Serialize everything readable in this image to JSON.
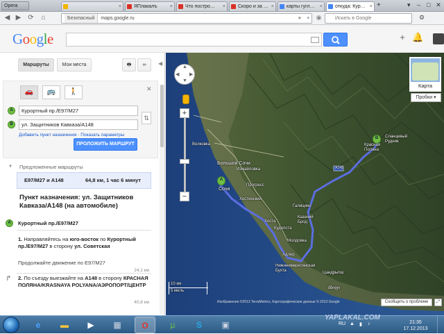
{
  "browser": {
    "menu_label": "Opera",
    "tabs": [
      {
        "label": "",
        "color": "#f4b400"
      },
      {
        "label": "ЯПлакалъ",
        "color": "#d93025"
      },
      {
        "label": "Что постро…",
        "color": "#d93025"
      },
      {
        "label": "Скоро и за …",
        "color": "#d93025"
      },
      {
        "label": "карты гугл…",
        "color": "#4285f4"
      },
      {
        "label": "откуда: Кур…",
        "color": "#4285f4"
      }
    ],
    "security_label": "Безопасный",
    "url": "maps.google.ru",
    "search_placeholder": "Искать в Google"
  },
  "header": {
    "logo": "Google"
  },
  "panel": {
    "tab_routes": "Маршруты",
    "tab_myplaces": "Мои места",
    "pin_a": "A",
    "pin_b": "B",
    "field_a": "Курортный пр./E97/M27",
    "field_b": "ул. Защитников Кавказа/A148",
    "add_dest": "Добавить пункт назначения",
    "sep": " · ",
    "show_params": "Показать параметры",
    "submit": "ПРОЛОЖИТЬ МАРШРУТ",
    "suggested": "Предложенные маршруты",
    "route_name": "E97/M27 и A148",
    "route_stats": "64,8 км, 1 час 6 минут",
    "destination_title": "Пункт назначения: ул. Защитников Кавказа/A148 (на автомобиле)",
    "start_label": "Курортный пр./E97/M27",
    "step1_num": "1.",
    "step1_a": "Направляйтесь на ",
    "step1_b": "юго-восток",
    "step1_c": " по ",
    "step1_d": "Курортный пр./E97/M27",
    "step1_e": " в сторону ",
    "step1_f": "ул. Советская",
    "step1_cont": "Продолжайте движение по E97/M27",
    "step1_dist": "24,1 км",
    "step2_num": "2.",
    "step2_a": "По съезду выезжайте на ",
    "step2_b": "A148",
    "step2_c": " в сторону ",
    "step2_d": "КРАСНАЯ ПОЛЯНА/KRASNAYA POLYANA/АЭРОПОРТ/ЦЕНТР",
    "step2_dist": "40,8 км"
  },
  "map": {
    "labels": {
      "volkovka": "Волковка",
      "bolshoy_sochi": "Большой Сочи",
      "sochi": "Сочи",
      "izmaylovka": "Измайловка",
      "progress": "Прогресс",
      "khostinsky": "Хостинский",
      "khosta": "Хоста",
      "kudepsta": "Кудепста",
      "galitsino": "Галицино",
      "kazachiy_brod": "Казачий Брод",
      "moldovka": "Молдовка",
      "adler": "Адлер",
      "nizhneimeretinskaya": "Нижнеимеретинская Бухта",
      "chandrypsh": "Цандрыпш",
      "krasnaya_polyana": "Красная Поляна",
      "slantsevy_rudnik": "Сланцевый Рудник",
      "georgian": "ბზიფი",
      "a148": "A148"
    },
    "karta_btn": "Карта",
    "traffic_btn": "Пробки",
    "scale_km": "10 км",
    "scale_mi": "5 миль",
    "attribution": "Изображения ©2013 TerraMetrics, Картографические данные © 2013 Google",
    "report_btn": "Сообщить о проблеме",
    "route_color": "#5b6ee1"
  },
  "taskbar": {
    "lang": "RU",
    "time": "21:35",
    "date": "17.12.2013",
    "watermark": "YAPLAKAL.COM"
  }
}
